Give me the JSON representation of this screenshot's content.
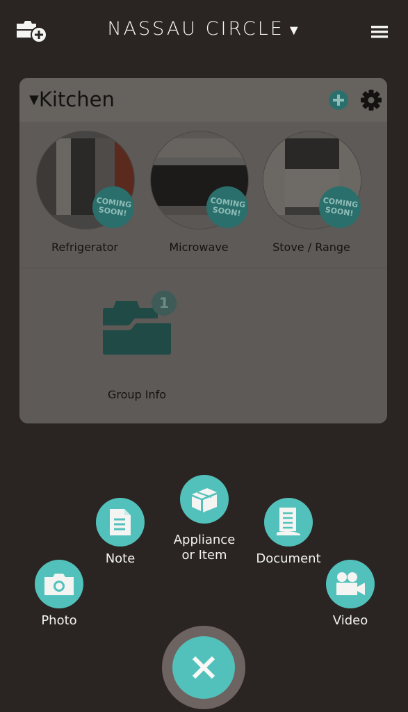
{
  "header": {
    "title": "NASSAU CIRCLE",
    "title_caret": "▼",
    "left_icon": "folder-add-icon",
    "right_icon": "hamburger-menu-icon"
  },
  "group": {
    "title": "Kitchen",
    "collapse_caret": "▼",
    "add_icon": "plus-circle-icon",
    "settings_icon": "gear-icon",
    "items": [
      {
        "label": "Refrigerator",
        "badge": "COMING SOON!"
      },
      {
        "label": "Microwave",
        "badge": "COMING SOON!"
      },
      {
        "label": "Stove / Range",
        "badge": "COMING SOON!"
      }
    ],
    "group_info": {
      "label": "Group Info",
      "count": "1"
    }
  },
  "actions": {
    "appliance": {
      "line1": "Appliance",
      "line2": "or Item",
      "icon": "box-icon"
    },
    "note": {
      "label": "Note",
      "icon": "note-icon"
    },
    "document": {
      "label": "Document",
      "icon": "document-icon"
    },
    "photo": {
      "label": "Photo",
      "icon": "camera-icon"
    },
    "video": {
      "label": "Video",
      "icon": "video-camera-icon"
    },
    "close_icon": "close-icon"
  },
  "colors": {
    "accent": "#53c1bb",
    "background": "#2a2523",
    "card_dimmed": "#5d5a57",
    "badge_dimmed": "#2a6f6b"
  }
}
